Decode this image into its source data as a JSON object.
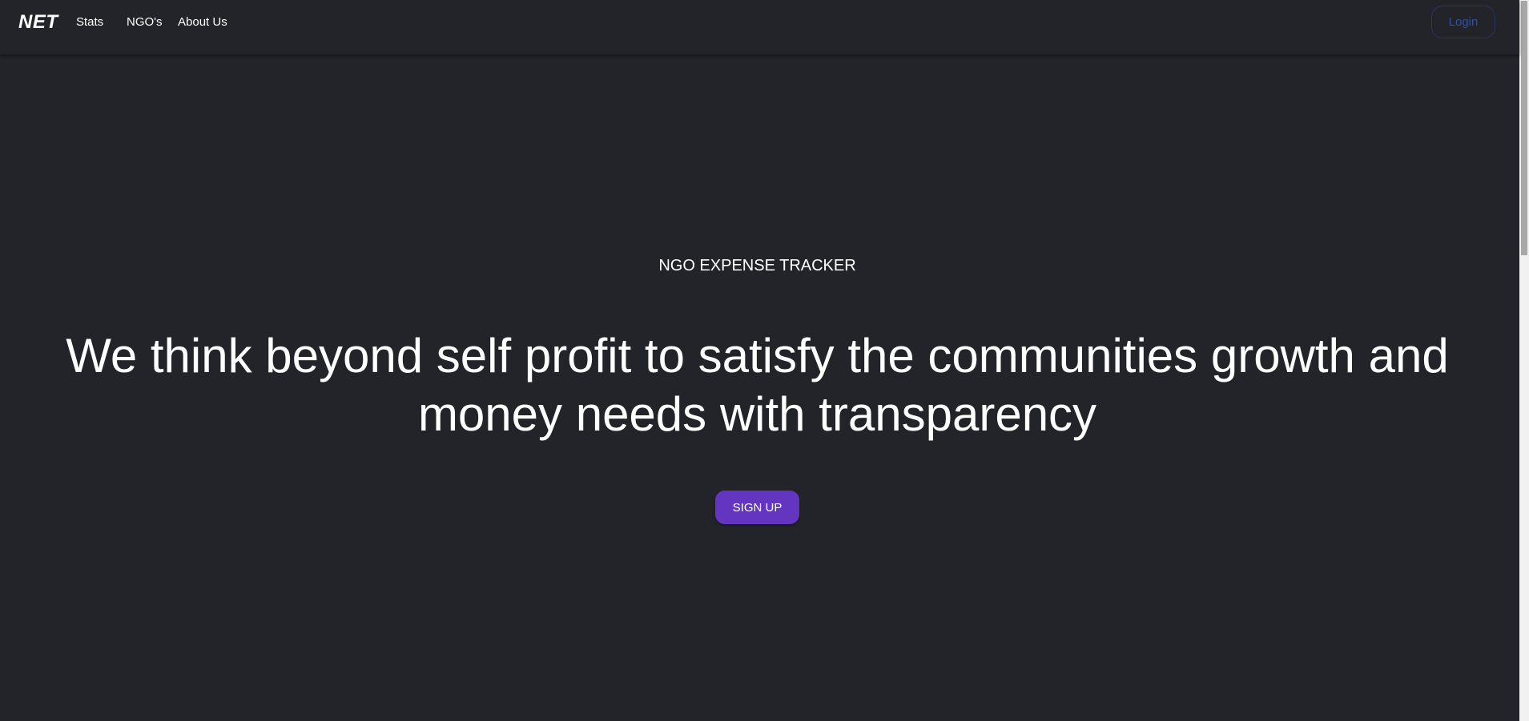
{
  "navbar": {
    "brand": "NET",
    "links": [
      {
        "label": "Stats"
      },
      {
        "label": "NGO's"
      },
      {
        "label": "About Us"
      }
    ],
    "login_label": "Login"
  },
  "hero": {
    "kicker": "NGO EXPENSE TRACKER",
    "headline": "We think beyond self profit to satisfy the communities growth and money needs with transparency",
    "cta_label": "SIGN UP"
  },
  "colors": {
    "background": "#23242a",
    "cta": "#6435c1",
    "login_text": "#2f4fa8"
  }
}
